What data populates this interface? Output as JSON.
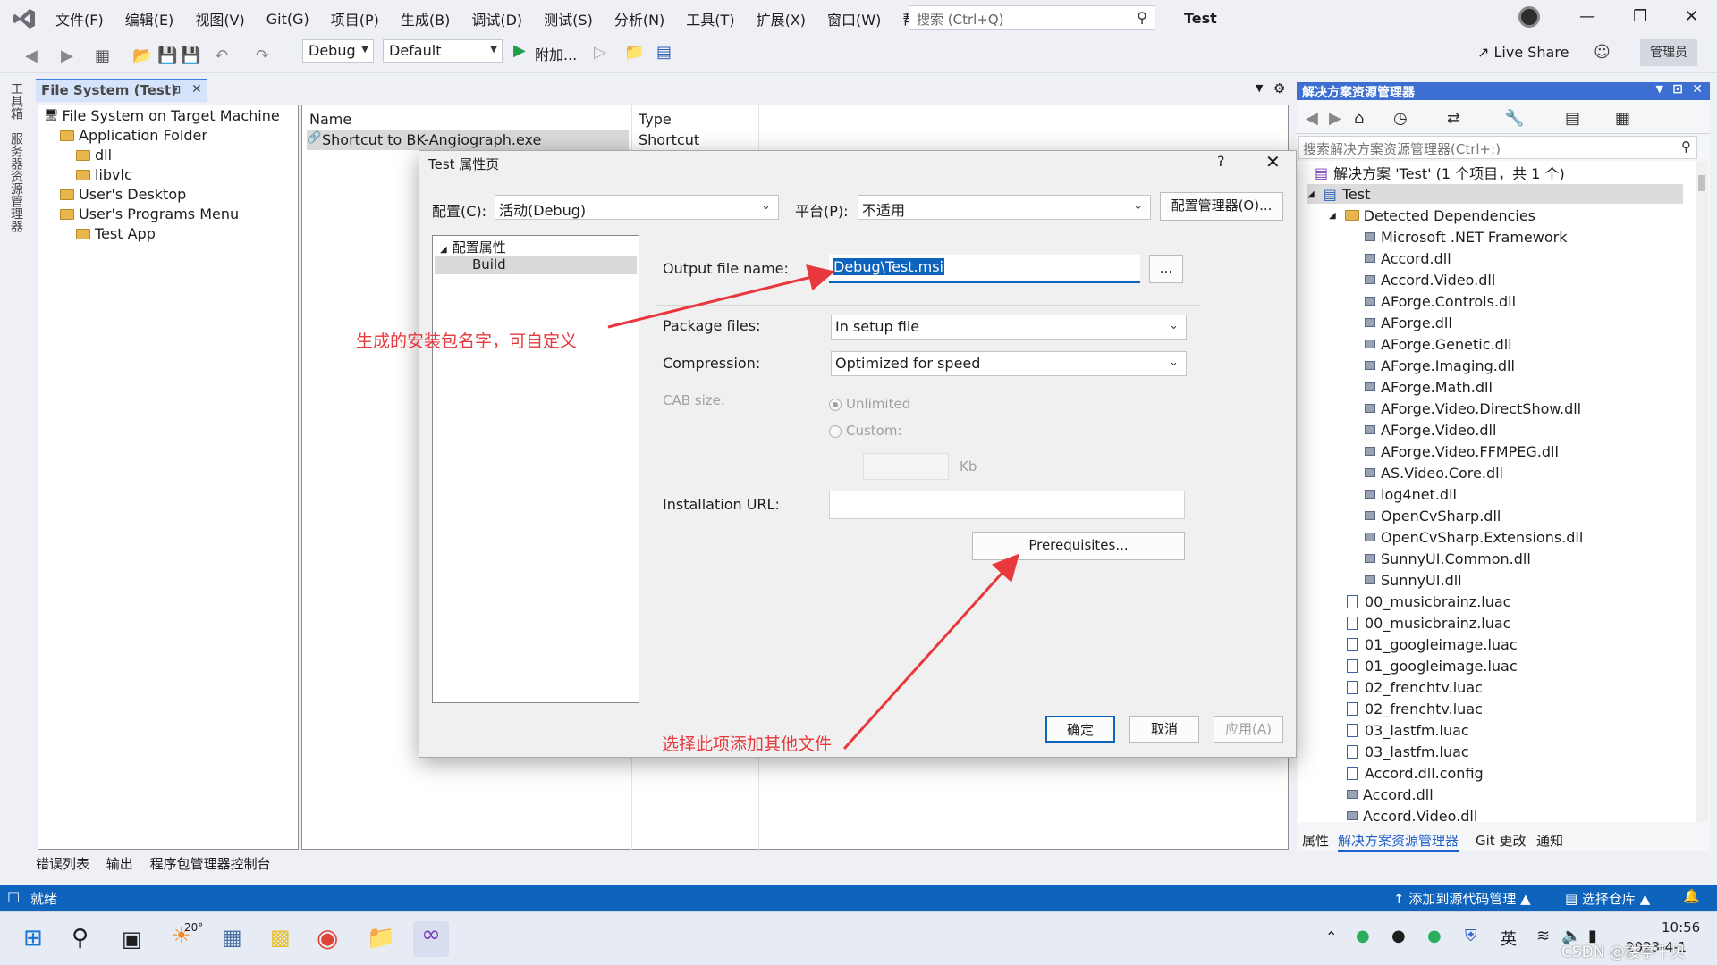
{
  "menubar": {
    "items": [
      "文件(F)",
      "编辑(E)",
      "视图(V)",
      "Git(G)",
      "项目(P)",
      "生成(B)",
      "调试(D)",
      "测试(S)",
      "分析(N)",
      "工具(T)",
      "扩展(X)",
      "窗口(W)",
      "帮助(H)"
    ],
    "search_placeholder": "搜索 (Ctrl+Q)",
    "project_title": "Test"
  },
  "toolbar": {
    "config": "Debug",
    "platform": "Default",
    "attach_label": "附加...",
    "live_share": "Live Share",
    "admin_badge": "管理员"
  },
  "side_tabs": {
    "toolbox": "工具箱",
    "server_explorer": "服务器资源管理器"
  },
  "file_system": {
    "tab_title": "File System (Test)",
    "tree": [
      {
        "label": "File System on Target Machine"
      },
      {
        "label": "Application Folder"
      },
      {
        "label": "dll"
      },
      {
        "label": "libvlc"
      },
      {
        "label": "User's Desktop"
      },
      {
        "label": "User's Programs Menu"
      },
      {
        "label": "Test App"
      }
    ],
    "columns": [
      "Name",
      "Type"
    ],
    "rows": [
      {
        "name": "Shortcut to BK-Angiograph.exe",
        "type": "Shortcut"
      }
    ]
  },
  "bottom_tabs": [
    "错误列表",
    "输出",
    "程序包管理器控制台"
  ],
  "status": {
    "ready": "就绪",
    "add_source": "添加到源代码管理",
    "select_repo": "选择仓库"
  },
  "solution_explorer": {
    "title": "解决方案资源管理器",
    "search_placeholder": "搜索解决方案资源管理器(Ctrl+;)",
    "solution_label": "解决方案 'Test' (1 个项目，共 1 个)",
    "project_label": "Test",
    "detected_label": "Detected Dependencies",
    "dependencies": [
      "Microsoft .NET Framework",
      "Accord.dll",
      "Accord.Video.dll",
      "AForge.Controls.dll",
      "AForge.dll",
      "AForge.Genetic.dll",
      "AForge.Imaging.dll",
      "AForge.Math.dll",
      "AForge.Video.DirectShow.dll",
      "AForge.Video.dll",
      "AForge.Video.FFMPEG.dll",
      "AS.Video.Core.dll",
      "log4net.dll",
      "OpenCvSharp.dll",
      "OpenCvSharp.Extensions.dll",
      "SunnyUI.Common.dll",
      "SunnyUI.dll"
    ],
    "files": [
      "00_musicbrainz.luac",
      "00_musicbrainz.luac",
      "01_googleimage.luac",
      "01_googleimage.luac",
      "02_frenchtv.luac",
      "02_frenchtv.luac",
      "03_lastfm.luac",
      "03_lastfm.luac",
      "Accord.dll.config"
    ],
    "extra": [
      "Accord.dll",
      "Accord.Video.dll"
    ],
    "bottom_tabs": [
      "属性",
      "解决方案资源管理器",
      "Git 更改",
      "通知"
    ]
  },
  "dialog": {
    "title": "Test 属性页",
    "config_label": "配置(C):",
    "config_value": "活动(Debug)",
    "platform_label": "平台(P):",
    "platform_value": "不适用",
    "config_manager": "配置管理器(O)...",
    "tree_root": "配置属性",
    "tree_child": "Build",
    "output_label": "Output file name:",
    "output_value": "Debug\\Test.msi",
    "browse": "...",
    "package_label": "Package files:",
    "package_value": "In setup file",
    "compression_label": "Compression:",
    "compression_value": "Optimized for speed",
    "cab_label": "CAB size:",
    "unlimited": "Unlimited",
    "custom": "Custom:",
    "kb": "Kb",
    "install_url_label": "Installation URL:",
    "install_url_value": "",
    "prerequisites": "Prerequisites...",
    "ok": "确定",
    "cancel": "取消",
    "apply": "应用(A)"
  },
  "annotations": {
    "name_note": "生成的安装包名字，可自定义",
    "prereq_note": "选择此项添加其他文件",
    "color": "#e8383d"
  },
  "taskbar": {
    "weather_temp": "20°",
    "ime": "英",
    "time": "10:56",
    "date": "2023-4-1",
    "watermark": "CSDN @楼亭千贝"
  }
}
